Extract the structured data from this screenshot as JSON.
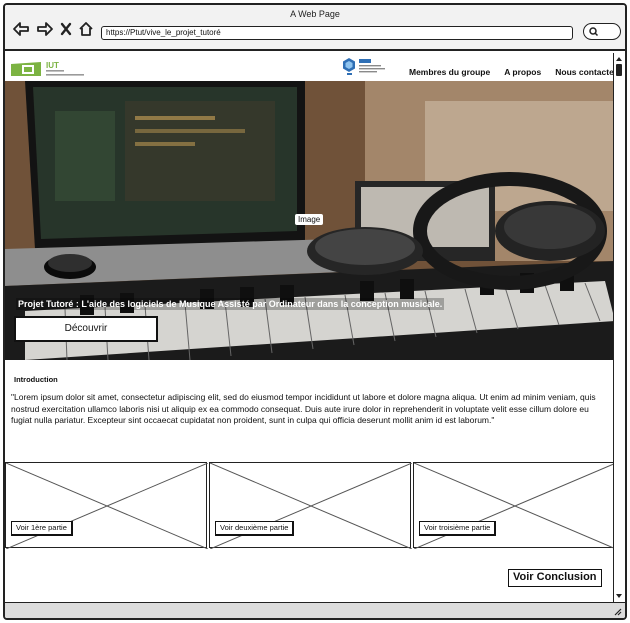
{
  "browser": {
    "window_title": "A Web Page",
    "url": "https://Ptut/vive_le_projet_tutoré"
  },
  "header": {
    "logo_text": "IUT",
    "nav": [
      "Membres du groupe",
      "A propos",
      "Nous contacter"
    ]
  },
  "hero": {
    "image_label": "Image",
    "title": "Projet Tutoré : L'aide des logiciels de Musique Assisté par Ordinateur dans la conception musicale.",
    "button": "Découvrir"
  },
  "intro": {
    "heading": "Introduction",
    "text": "\"Lorem ipsum dolor sit amet, consectetur adipiscing elit, sed do eiusmod tempor incididunt ut labore et dolore magna aliqua. Ut enim ad minim veniam, quis nostrud exercitation ullamco laboris nisi ut aliquip ex ea commodo consequat. Duis aute irure dolor in reprehenderit in voluptate velit esse cillum dolore eu fugiat nulla pariatur. Excepteur sint occaecat cupidatat non proident, sunt in culpa qui officia deserunt mollit anim id est laborum.\""
  },
  "cards": [
    {
      "button": "Voir 1ère partie"
    },
    {
      "button": "Voir deuxième partie"
    },
    {
      "button": "Voir troisième partie"
    }
  ],
  "conclusion_button": "Voir Conclusion",
  "colors": {
    "logo_green": "#7cb342",
    "info_blue": "#2f6fb5"
  }
}
